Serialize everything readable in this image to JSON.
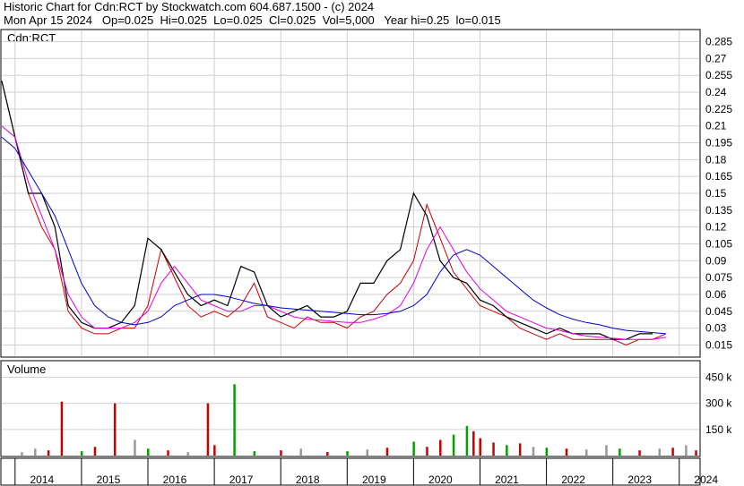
{
  "header": {
    "line1": "Historic Chart for Cdn:RCT by Stockwatch.com 604.687.1500 - (c) 2024",
    "line2": "Mon Apr 15 2024   Op=0.025  Hi=0.025  Lo=0.025  Cl=0.025  Vol=5,000   Year hi=0.25  lo=0.015"
  },
  "chart_data": [
    {
      "type": "line",
      "panel": "price",
      "title": "Cdn:RCT",
      "ylim": [
        0.005,
        0.295
      ],
      "y_ticks": [
        "0.285",
        "0.27",
        "0.255",
        "0.24",
        "0.225",
        "0.21",
        "0.195",
        "0.18",
        "0.165",
        "0.15",
        "0.135",
        "0.12",
        "0.105",
        "0.09",
        "0.075",
        "0.06",
        "0.045",
        "0.03",
        "0.015"
      ],
      "grid": true,
      "x": [
        2013.8,
        2014.0,
        2014.2,
        2014.4,
        2014.6,
        2014.8,
        2015.0,
        2015.2,
        2015.4,
        2015.6,
        2015.8,
        2016.0,
        2016.2,
        2016.4,
        2016.6,
        2016.8,
        2017.0,
        2017.2,
        2017.4,
        2017.6,
        2017.8,
        2018.0,
        2018.2,
        2018.4,
        2018.6,
        2018.8,
        2019.0,
        2019.2,
        2019.4,
        2019.6,
        2019.8,
        2020.0,
        2020.2,
        2020.4,
        2020.6,
        2020.8,
        2021.0,
        2021.2,
        2021.4,
        2021.6,
        2021.8,
        2022.0,
        2022.2,
        2022.4,
        2022.6,
        2022.8,
        2023.0,
        2023.2,
        2023.4,
        2023.6,
        2023.8,
        2024.0,
        2024.2
      ],
      "series": [
        {
          "role": "close",
          "color": "#c80000",
          "values": [
            0.25,
            0.2,
            0.15,
            0.12,
            0.1,
            0.045,
            0.03,
            0.025,
            0.025,
            0.03,
            0.03,
            0.05,
            0.1,
            0.075,
            0.05,
            0.04,
            0.045,
            0.04,
            0.05,
            0.07,
            0.04,
            0.035,
            0.03,
            0.04,
            0.035,
            0.035,
            0.03,
            0.04,
            0.045,
            0.06,
            0.07,
            0.09,
            0.14,
            0.11,
            0.08,
            0.065,
            0.05,
            0.045,
            0.04,
            0.03,
            0.025,
            0.02,
            0.025,
            0.02,
            0.02,
            0.02,
            0.02,
            0.015,
            0.02,
            0.02,
            0.025
          ]
        },
        {
          "role": "high-low",
          "color": "#000000",
          "values": [
            0.25,
            0.2,
            0.15,
            0.15,
            0.12,
            0.05,
            0.035,
            0.03,
            0.03,
            0.035,
            0.05,
            0.11,
            0.1,
            0.08,
            0.06,
            0.05,
            0.055,
            0.05,
            0.085,
            0.08,
            0.05,
            0.04,
            0.045,
            0.05,
            0.04,
            0.04,
            0.045,
            0.07,
            0.07,
            0.09,
            0.1,
            0.15,
            0.13,
            0.09,
            0.075,
            0.07,
            0.055,
            0.05,
            0.04,
            0.035,
            0.03,
            0.025,
            0.03,
            0.025,
            0.025,
            0.025,
            0.02,
            0.02,
            0.025,
            0.025
          ]
        },
        {
          "role": "moving-average-short",
          "color": "#e000e0",
          "values": [
            0.21,
            0.2,
            0.16,
            0.13,
            0.1,
            0.06,
            0.04,
            0.03,
            0.03,
            0.03,
            0.035,
            0.045,
            0.07,
            0.085,
            0.07,
            0.055,
            0.05,
            0.045,
            0.045,
            0.05,
            0.05,
            0.045,
            0.04,
            0.038,
            0.037,
            0.036,
            0.035,
            0.035,
            0.038,
            0.042,
            0.05,
            0.07,
            0.1,
            0.12,
            0.1,
            0.08,
            0.065,
            0.055,
            0.045,
            0.04,
            0.035,
            0.03,
            0.028,
            0.025,
            0.023,
            0.022,
            0.021,
            0.02,
            0.02,
            0.02,
            0.022
          ]
        },
        {
          "role": "moving-average-long",
          "color": "#0000c8",
          "values": [
            0.2,
            0.19,
            0.17,
            0.15,
            0.13,
            0.1,
            0.07,
            0.05,
            0.04,
            0.035,
            0.033,
            0.035,
            0.04,
            0.05,
            0.055,
            0.06,
            0.06,
            0.058,
            0.055,
            0.052,
            0.05,
            0.048,
            0.047,
            0.046,
            0.045,
            0.044,
            0.043,
            0.042,
            0.042,
            0.043,
            0.045,
            0.05,
            0.06,
            0.08,
            0.095,
            0.1,
            0.095,
            0.085,
            0.075,
            0.065,
            0.055,
            0.048,
            0.042,
            0.038,
            0.035,
            0.033,
            0.03,
            0.028,
            0.027,
            0.026,
            0.025
          ]
        }
      ]
    },
    {
      "type": "bar",
      "panel": "volume",
      "title": "Volume",
      "y_ticks": [
        "450 k",
        "300 k",
        "150 k"
      ],
      "ylim": [
        0,
        540000
      ],
      "colors": {
        "up": "#00a000",
        "down": "#c80000",
        "flat": "#999999"
      },
      "bars": [
        {
          "x": 2014.7,
          "v": 310000,
          "c": "down"
        },
        {
          "x": 2015.5,
          "v": 300000,
          "c": "down"
        },
        {
          "x": 2016.9,
          "v": 300000,
          "c": "down"
        },
        {
          "x": 2017.3,
          "v": 410000,
          "c": "up"
        },
        {
          "x": 2014.1,
          "v": 20000,
          "c": "flat"
        },
        {
          "x": 2014.3,
          "v": 40000,
          "c": "flat"
        },
        {
          "x": 2014.5,
          "v": 30000,
          "c": "down"
        },
        {
          "x": 2015.0,
          "v": 25000,
          "c": "up"
        },
        {
          "x": 2015.2,
          "v": 50000,
          "c": "down"
        },
        {
          "x": 2015.8,
          "v": 90000,
          "c": "flat"
        },
        {
          "x": 2016.0,
          "v": 40000,
          "c": "up"
        },
        {
          "x": 2016.3,
          "v": 30000,
          "c": "down"
        },
        {
          "x": 2016.6,
          "v": 20000,
          "c": "flat"
        },
        {
          "x": 2017.0,
          "v": 60000,
          "c": "down"
        },
        {
          "x": 2017.6,
          "v": 25000,
          "c": "up"
        },
        {
          "x": 2018.0,
          "v": 30000,
          "c": "down"
        },
        {
          "x": 2018.3,
          "v": 40000,
          "c": "flat"
        },
        {
          "x": 2018.7,
          "v": 20000,
          "c": "down"
        },
        {
          "x": 2019.0,
          "v": 25000,
          "c": "up"
        },
        {
          "x": 2019.3,
          "v": 35000,
          "c": "flat"
        },
        {
          "x": 2019.6,
          "v": 45000,
          "c": "down"
        },
        {
          "x": 2020.0,
          "v": 80000,
          "c": "up"
        },
        {
          "x": 2020.2,
          "v": 50000,
          "c": "down"
        },
        {
          "x": 2020.4,
          "v": 90000,
          "c": "down"
        },
        {
          "x": 2020.6,
          "v": 120000,
          "c": "up"
        },
        {
          "x": 2020.8,
          "v": 170000,
          "c": "up"
        },
        {
          "x": 2020.9,
          "v": 140000,
          "c": "down"
        },
        {
          "x": 2021.0,
          "v": 100000,
          "c": "down"
        },
        {
          "x": 2021.2,
          "v": 75000,
          "c": "down"
        },
        {
          "x": 2021.4,
          "v": 60000,
          "c": "up"
        },
        {
          "x": 2021.6,
          "v": 70000,
          "c": "down"
        },
        {
          "x": 2021.8,
          "v": 50000,
          "c": "flat"
        },
        {
          "x": 2022.0,
          "v": 45000,
          "c": "up"
        },
        {
          "x": 2022.3,
          "v": 40000,
          "c": "down"
        },
        {
          "x": 2022.6,
          "v": 35000,
          "c": "flat"
        },
        {
          "x": 2022.9,
          "v": 60000,
          "c": "flat"
        },
        {
          "x": 2023.1,
          "v": 40000,
          "c": "up"
        },
        {
          "x": 2023.4,
          "v": 30000,
          "c": "down"
        },
        {
          "x": 2023.7,
          "v": 40000,
          "c": "flat"
        },
        {
          "x": 2023.9,
          "v": 45000,
          "c": "down"
        },
        {
          "x": 2024.1,
          "v": 60000,
          "c": "flat"
        },
        {
          "x": 2024.25,
          "v": 30000,
          "c": "down"
        }
      ]
    },
    {
      "type": "axis",
      "panel": "time",
      "x_ticks": [
        "2014",
        "2015",
        "2016",
        "2017",
        "2018",
        "2019",
        "2020",
        "2021",
        "2022",
        "2023",
        "2024"
      ]
    }
  ]
}
